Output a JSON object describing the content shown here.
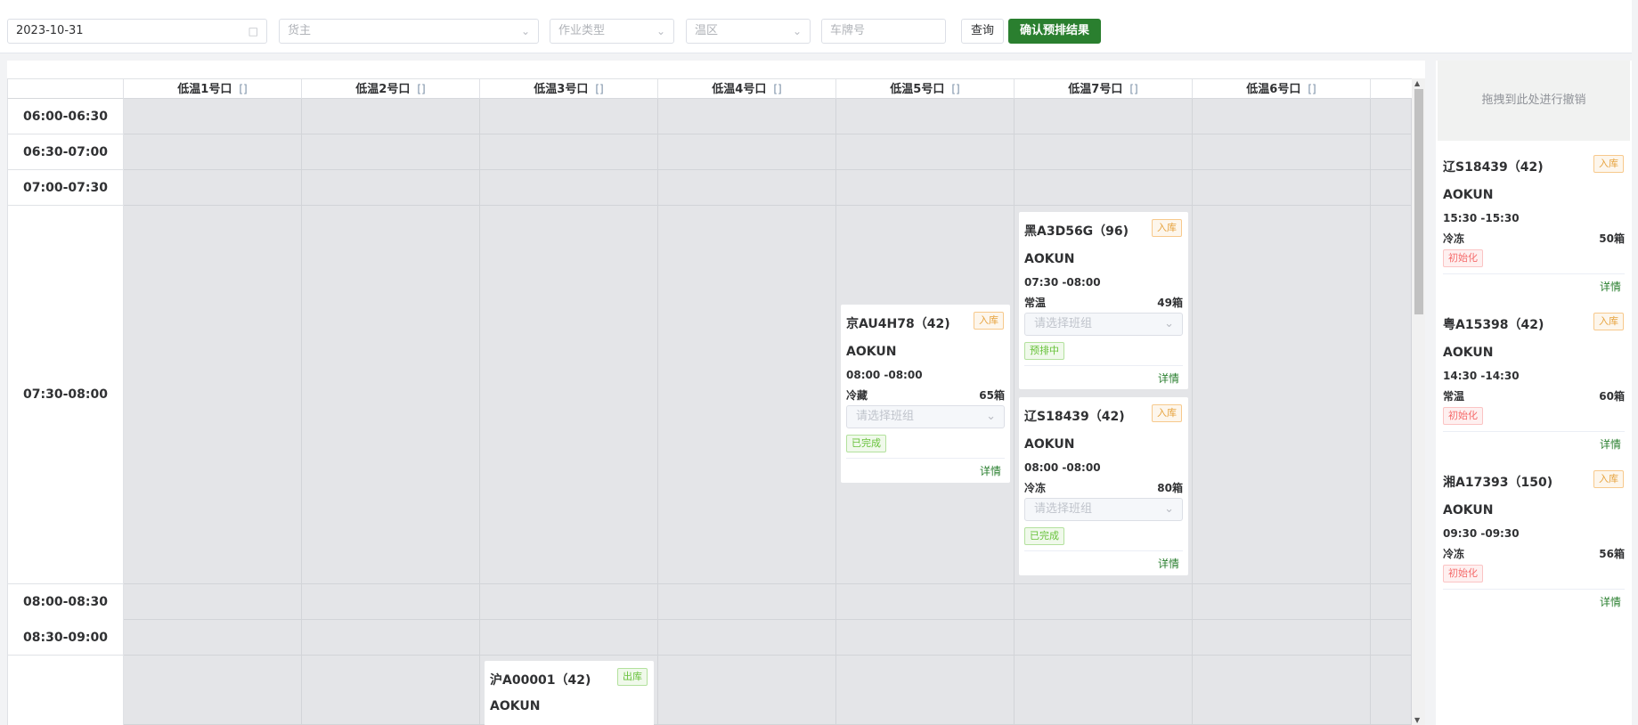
{
  "toolbar": {
    "date": "2023-10-31",
    "owner_placeholder": "货主",
    "op_type_placeholder": "作业类型",
    "temp_zone_placeholder": "温区",
    "plate_placeholder": "车牌号",
    "query_label": "查询",
    "confirm_label": "确认预排结果"
  },
  "columns": [
    {
      "name": "低温1号口",
      "mark": "[]"
    },
    {
      "name": "低温2号口",
      "mark": "[]"
    },
    {
      "name": "低温3号口",
      "mark": "[]"
    },
    {
      "name": "低温4号口",
      "mark": "[]"
    },
    {
      "name": "低温5号口",
      "mark": "[]"
    },
    {
      "name": "低温7号口",
      "mark": "[]"
    },
    {
      "name": "低温6号口",
      "mark": "[]"
    }
  ],
  "time_slots": [
    "06:00-06:30",
    "06:30-07:00",
    "07:00-07:30",
    "07:30-08:00",
    "08:00-08:30",
    "08:30-09:00"
  ],
  "cards": [
    {
      "plate": "京AU4H78（42)",
      "tag": "入库",
      "owner": "AOKUN",
      "time": "08:00 -08:00",
      "temp": "冷藏",
      "qty": "65箱",
      "select_placeholder": "请选择班组",
      "status": "已完成",
      "detail": "详情"
    },
    {
      "plate": "黑A3D56G（96)",
      "tag": "入库",
      "owner": "AOKUN",
      "time": "07:30 -08:00",
      "temp": "常温",
      "qty": "49箱",
      "select_placeholder": "请选择班组",
      "status": "预排中",
      "detail": "详情"
    },
    {
      "plate": "辽S18439（42)",
      "tag": "入库",
      "owner": "AOKUN",
      "time": "08:00 -08:00",
      "temp": "冷冻",
      "qty": "80箱",
      "select_placeholder": "请选择班组",
      "status": "已完成",
      "detail": "详情"
    },
    {
      "plate": "沪A00001（42)",
      "tag": "出库",
      "owner": "AOKUN"
    }
  ],
  "sidebar": {
    "drop_text": "拖拽到此处进行撤销",
    "cards": [
      {
        "plate": "辽S18439（42)",
        "tag": "入库",
        "owner": "AOKUN",
        "time": "15:30 -15:30",
        "temp": "冷冻",
        "qty": "50箱",
        "status": "初始化",
        "detail": "详情"
      },
      {
        "plate": "粤A15398（42)",
        "tag": "入库",
        "owner": "AOKUN",
        "time": "14:30 -14:30",
        "temp": "常温",
        "qty": "60箱",
        "status": "初始化",
        "detail": "详情"
      },
      {
        "plate": "湘A17393（150)",
        "tag": "入库",
        "owner": "AOKUN",
        "time": "09:30 -09:30",
        "temp": "冷冻",
        "qty": "56箱",
        "status": "初始化",
        "detail": "详情"
      }
    ]
  },
  "colors": {
    "primary": "#2a7f2f",
    "slot_bg": "#e4e5e8",
    "tag_orange": "#e6a23c",
    "status_green": "#67c23a",
    "status_red": "#f56c6c"
  },
  "icons": [
    "calendar-icon",
    "chevron-down-icon"
  ]
}
